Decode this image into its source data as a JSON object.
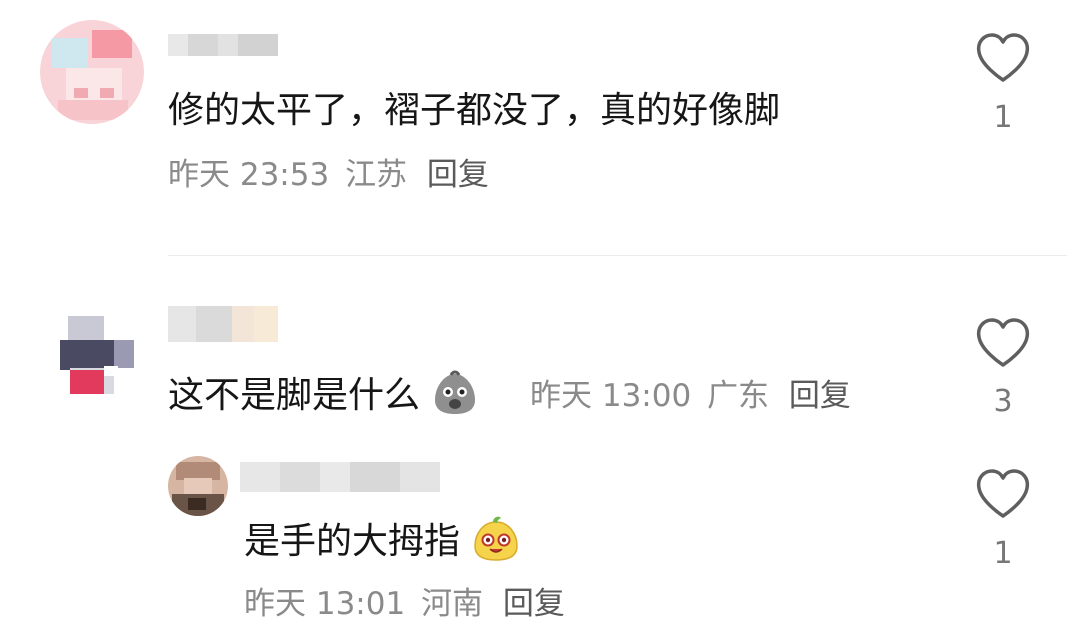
{
  "comments": [
    {
      "text": "修的太平了，褶子都没了，真的好像脚",
      "time": "昨天 23:53",
      "location": "江苏",
      "reply_label": "回复",
      "like_count": "1",
      "avatar_colors": [
        "#f9d3d6",
        "#f59aa5",
        "#ffffff",
        "#cfe7ef"
      ]
    },
    {
      "text": "这不是脚是什么",
      "emoji": "grimace-blob-emoji",
      "time": "昨天 13:00",
      "location": "广东",
      "reply_label": "回复",
      "like_count": "3",
      "avatar_colors": [
        "#4b4a63",
        "#d9d9e2",
        "#e23a5d",
        "#9a9ab2"
      ]
    },
    {
      "text": "是手的大拇指",
      "emoji": "yellow-blob-emoji",
      "time": "昨天 13:01",
      "location": "河南",
      "reply_label": "回复",
      "like_count": "1",
      "avatar_colors": [
        "#6a5347",
        "#b28a78",
        "#3b2b22",
        "#d6b6a3"
      ]
    }
  ],
  "colors": {
    "text": "#161616",
    "meta": "#8a8a8a",
    "reply": "#5a5a5a",
    "icon": "#5f5f5f",
    "divider": "#ececec"
  },
  "icons": {
    "like": "heart-outline-icon"
  }
}
